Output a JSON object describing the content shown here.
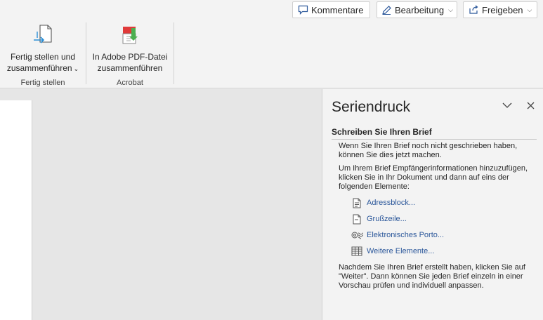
{
  "top_buttons": {
    "comments_label": "Kommentare",
    "editing_label": "Bearbeitung",
    "share_label": "Freigeben"
  },
  "ribbon": {
    "groups": [
      {
        "label": "Fertig stellen",
        "command_line1": "Fertig stellen und",
        "command_line2": "zusammenführen"
      },
      {
        "label": "Acrobat",
        "command_line1": "In Adobe PDF-Datei",
        "command_line2": "zusammenführen"
      }
    ]
  },
  "pane": {
    "title": "Seriendruck",
    "section_heading": "Schreiben Sie Ihren Brief",
    "intro_text": "Wenn Sie Ihren Brief noch nicht geschrieben haben, können Sie dies jetzt machen.",
    "instruction_text": "Um Ihrem Brief Empfängerinformationen hinzuzufügen, klicken Sie in Ihr Dokument und dann auf eins der folgenden Elemente:",
    "links": [
      {
        "label": "Adressblock...",
        "icon": "document-icon"
      },
      {
        "label": "Grußzeile...",
        "icon": "document-icon"
      },
      {
        "label": "Elektronisches Porto...",
        "icon": "postage-icon"
      },
      {
        "label": "Weitere Elemente...",
        "icon": "table-icon"
      }
    ],
    "footer_text": "Nachdem Sie Ihren Brief erstellt haben, klicken Sie auf \"Weiter\". Dann können Sie jeden Brief einzeln in einer Vorschau prüfen und individuell anpassen."
  },
  "colors": {
    "link": "#2b579a",
    "ribbon_bg": "#f3f3f3",
    "canvas_bg": "#e6e6e6"
  }
}
